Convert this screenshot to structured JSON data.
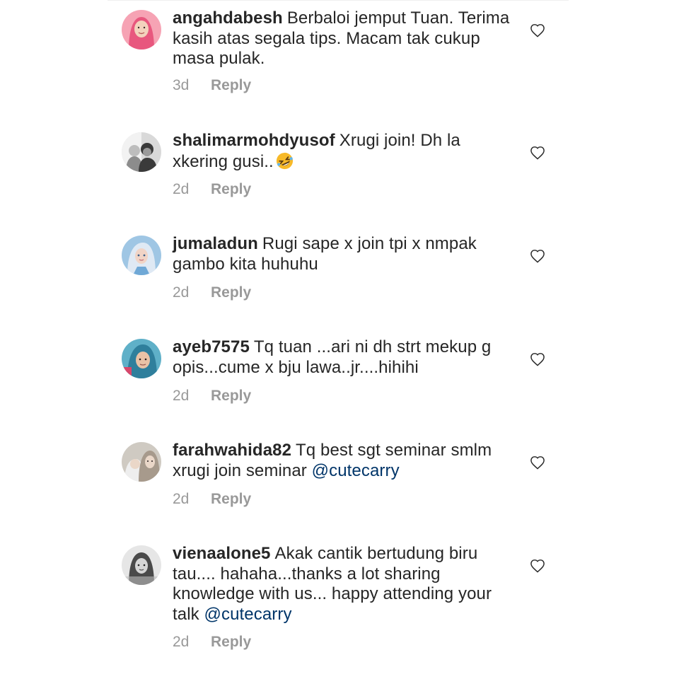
{
  "comments": [
    {
      "username": "angahdabesh",
      "text": "Berbaloi jemput Tuan. Terima kasih atas segala tips. Macam tak cukup masa pulak.",
      "mention": "",
      "age": "3d",
      "reply_label": "Reply",
      "avatar_colors": [
        "#f6a3b4",
        "#e8577e",
        "#f3d2bd"
      ]
    },
    {
      "username": "shalimarmohdyusof",
      "text": "Xrugi join! Dh la xkering gusi..",
      "emoji": "rolling-on-floor-laughing-emoji",
      "mention": "",
      "age": "2d",
      "reply_label": "Reply",
      "avatar_colors": [
        "#d9d9d9",
        "#3a3a3a",
        "#f2f2f2"
      ]
    },
    {
      "username": "jumaladun",
      "text": "Rugi sape x join tpi x nmpak gambo kita huhuhu",
      "mention": "",
      "age": "2d",
      "reply_label": "Reply",
      "avatar_colors": [
        "#9fc6e4",
        "#dfe9f4",
        "#f1d4c6"
      ]
    },
    {
      "username": "ayeb7575",
      "text": "Tq tuan ...ari ni dh strt mekup g opis...cume x bju lawa..jr....hihihi",
      "mention": "",
      "age": "2d",
      "reply_label": "Reply",
      "avatar_colors": [
        "#5fb0c8",
        "#2f7f9c",
        "#e9c2a6"
      ]
    },
    {
      "username": "farahwahida82",
      "text": "Tq best sgt seminar smlm xrugi join seminar",
      "mention": "@cutecarry",
      "age": "2d",
      "reply_label": "Reply",
      "avatar_colors": [
        "#cfcac2",
        "#a79a8c",
        "#ead7c8"
      ]
    },
    {
      "username": "vienaalone5",
      "text": "Akak cantik bertudung biru tau.... hahaha...thanks a lot sharing knowledge with us... happy attending your talk",
      "mention": "@cutecarry",
      "age": "2d",
      "reply_label": "Reply",
      "avatar_colors": [
        "#e6e6e6",
        "#4a4a4a",
        "#bdbdbd"
      ]
    }
  ],
  "icons": {
    "like": "heart-outline-icon"
  },
  "colors": {
    "text": "#262626",
    "meta": "#999999",
    "mention": "#003569",
    "heart": "#262626"
  }
}
